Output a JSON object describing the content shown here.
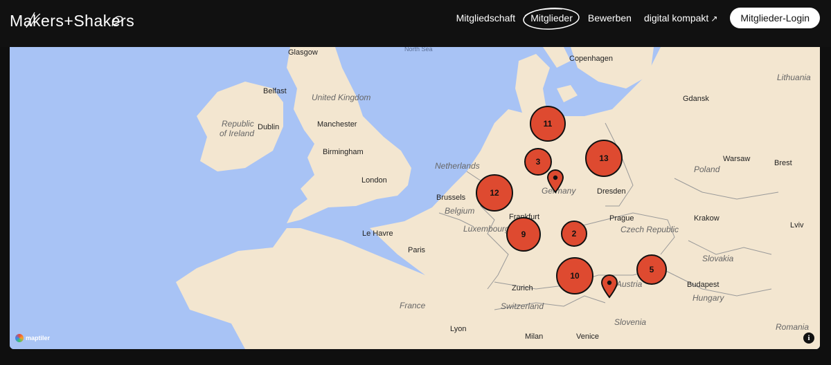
{
  "header": {
    "logo_text": "Makers+Shakers",
    "nav": [
      {
        "label": "Mitgliedschaft"
      },
      {
        "label": "Mitglieder",
        "active": true
      },
      {
        "label": "Bewerben"
      },
      {
        "label": "digital kompakt",
        "external": true
      }
    ],
    "login_label": "Mitglieder-Login"
  },
  "map": {
    "labels": {
      "north_sea": "North Sea",
      "glasgow": "Glasgow",
      "belfast": "Belfast",
      "united_kingdom": "United Kingdom",
      "republic_of": "Republic",
      "of_ireland": "of Ireland",
      "dublin": "Dublin",
      "manchester": "Manchester",
      "birmingham": "Birmingham",
      "london": "London",
      "netherlands": "Netherlands",
      "brussels": "Brussels",
      "belgium": "Belgium",
      "luxembourg": "Luxembourg",
      "le_havre": "Le Havre",
      "paris": "Paris",
      "france": "France",
      "lyon": "Lyon",
      "copenhagen": "Copenhagen",
      "germany": "Germany",
      "frankfurt": "Frankfurt",
      "dresden": "Dresden",
      "prague": "Prague",
      "czech_republic": "Czech Republic",
      "zurich": "Zurich",
      "switzerland": "Switzerland",
      "austria": "Austria",
      "milan": "Milan",
      "venice": "Venice",
      "slovenia": "Slovenia",
      "gdansk": "Gdansk",
      "lithuania": "Lithuania",
      "warsaw": "Warsaw",
      "brest": "Brest",
      "poland": "Poland",
      "krakow": "Krakow",
      "lviv": "Lviv",
      "slovakia": "Slovakia",
      "budapest": "Budapest",
      "hungary": "Hungary",
      "romania": "Romania"
    },
    "clusters": [
      {
        "count": "11"
      },
      {
        "count": "3"
      },
      {
        "count": "13"
      },
      {
        "count": "12"
      },
      {
        "count": "9"
      },
      {
        "count": "2"
      },
      {
        "count": "10"
      },
      {
        "count": "5"
      }
    ],
    "attribution": "maptiler",
    "info_label": "i",
    "colors": {
      "water": "#a8c3f5",
      "land": "#f3e6d0",
      "cluster": "#de4a30"
    }
  }
}
